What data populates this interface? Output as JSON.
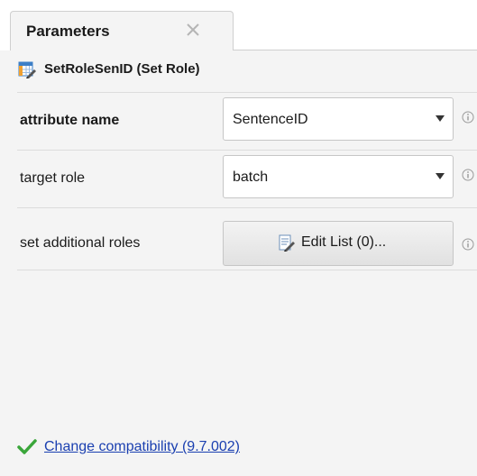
{
  "tab": {
    "title": "Parameters",
    "close_icon": "close-icon"
  },
  "operator": {
    "icon": "set-role-icon",
    "title": "SetRoleSenID (Set Role)"
  },
  "parameters": [
    {
      "label": "attribute name",
      "bold": true,
      "control": "dropdown",
      "value": "SentenceID",
      "info_icon": "info-icon"
    },
    {
      "label": "target role",
      "bold": false,
      "control": "dropdown",
      "value": "batch",
      "info_icon": "info-icon"
    },
    {
      "label": "set additional roles",
      "bold": false,
      "control": "button",
      "button_icon": "edit-list-icon",
      "button_label": "Edit List (0)...",
      "info_icon": "info-icon"
    }
  ],
  "footer": {
    "status_icon": "check-icon",
    "status_color": "#3aa63a",
    "link_text": "Change compatibility (9.7.002)"
  },
  "colors": {
    "link": "#1a3fb0",
    "panel_bg": "#f4f4f4"
  }
}
